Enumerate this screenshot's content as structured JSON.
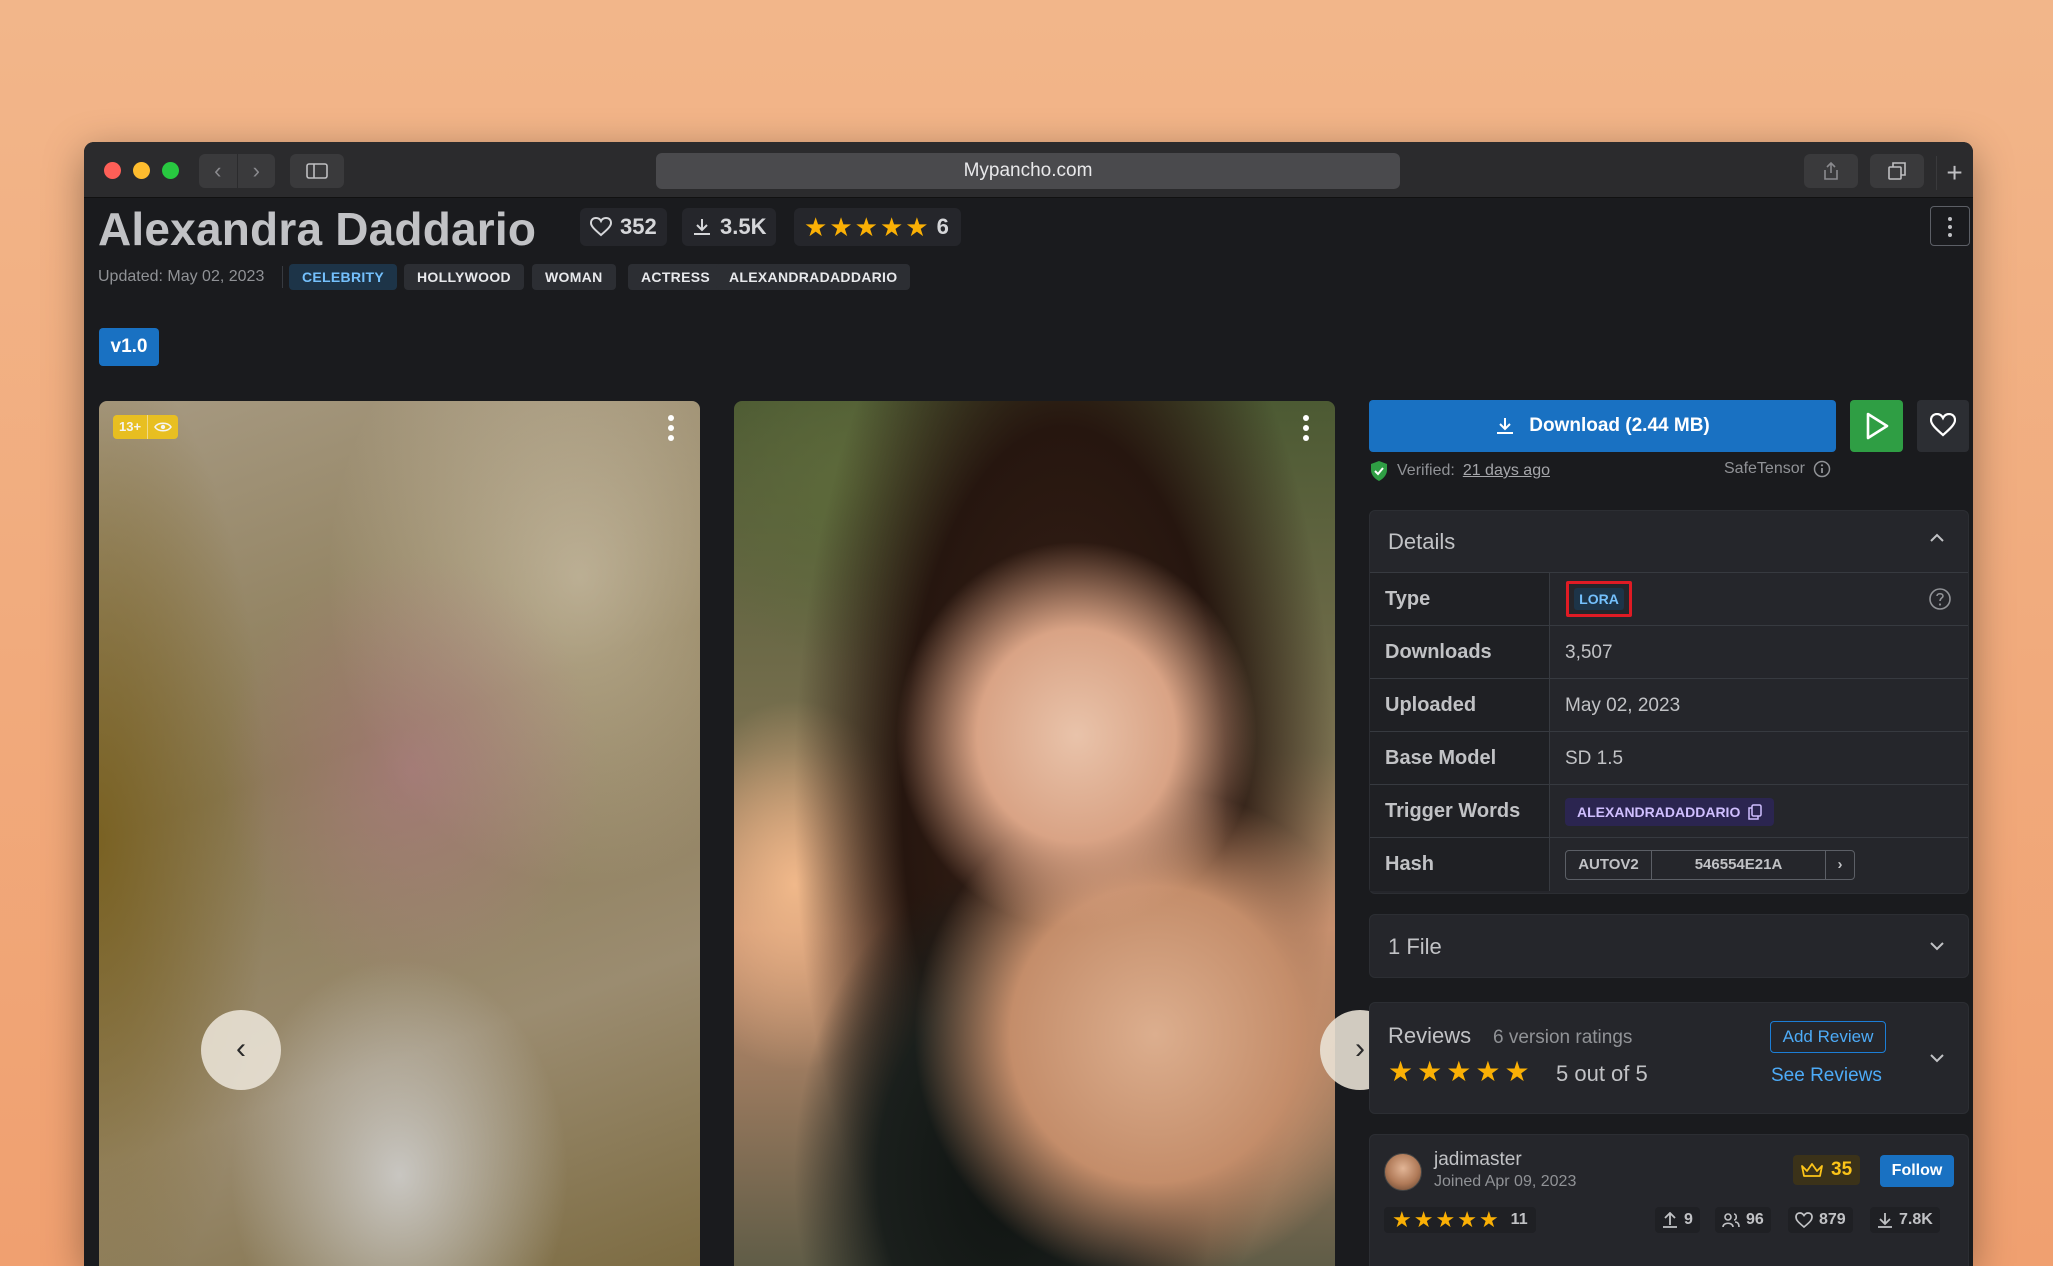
{
  "browser": {
    "url": "Mypancho.com"
  },
  "model": {
    "title": "Alexandra Daddario",
    "likes": "352",
    "downloads": "3.5K",
    "rating_count": "6",
    "updated": "Updated: May 02, 2023",
    "tags": [
      "CELEBRITY",
      "HOLLYWOOD",
      "WOMAN",
      "ACTRESS",
      "ALEXANDRADADDARIO"
    ],
    "version": "v1.0"
  },
  "gallery": {
    "nsfw_badge": "13+"
  },
  "actions": {
    "download_label": "Download (2.44 MB)",
    "verified_prefix": "Verified:",
    "verified_when": "21 days ago",
    "format": "SafeTensor"
  },
  "details": {
    "heading": "Details",
    "rows": {
      "type": {
        "label": "Type",
        "value": "LORA"
      },
      "downloads": {
        "label": "Downloads",
        "value": "3,507"
      },
      "uploaded": {
        "label": "Uploaded",
        "value": "May 02, 2023"
      },
      "base_model": {
        "label": "Base Model",
        "value": "SD 1.5"
      },
      "trigger_words": {
        "label": "Trigger Words",
        "value": "ALEXANDRADADDARIO"
      },
      "hash": {
        "label": "Hash",
        "algo": "AUTOV2",
        "value": "546554E21A"
      }
    }
  },
  "files": {
    "label": "1 File"
  },
  "reviews": {
    "title": "Reviews",
    "subtitle": "6 version ratings",
    "score": "5 out of 5",
    "add_label": "Add Review",
    "see_label": "See Reviews"
  },
  "creator": {
    "name": "jadimaster",
    "joined": "Joined Apr 09, 2023",
    "crowns": "35",
    "follow_label": "Follow",
    "rating_count": "11",
    "uploads": "9",
    "followers": "96",
    "likes": "879",
    "downloads": "7.8K"
  },
  "colors": {
    "accent_blue": "#1971c2",
    "accent_green": "#2f9e44",
    "star": "#fab005",
    "highlight_red": "#e01b24"
  }
}
